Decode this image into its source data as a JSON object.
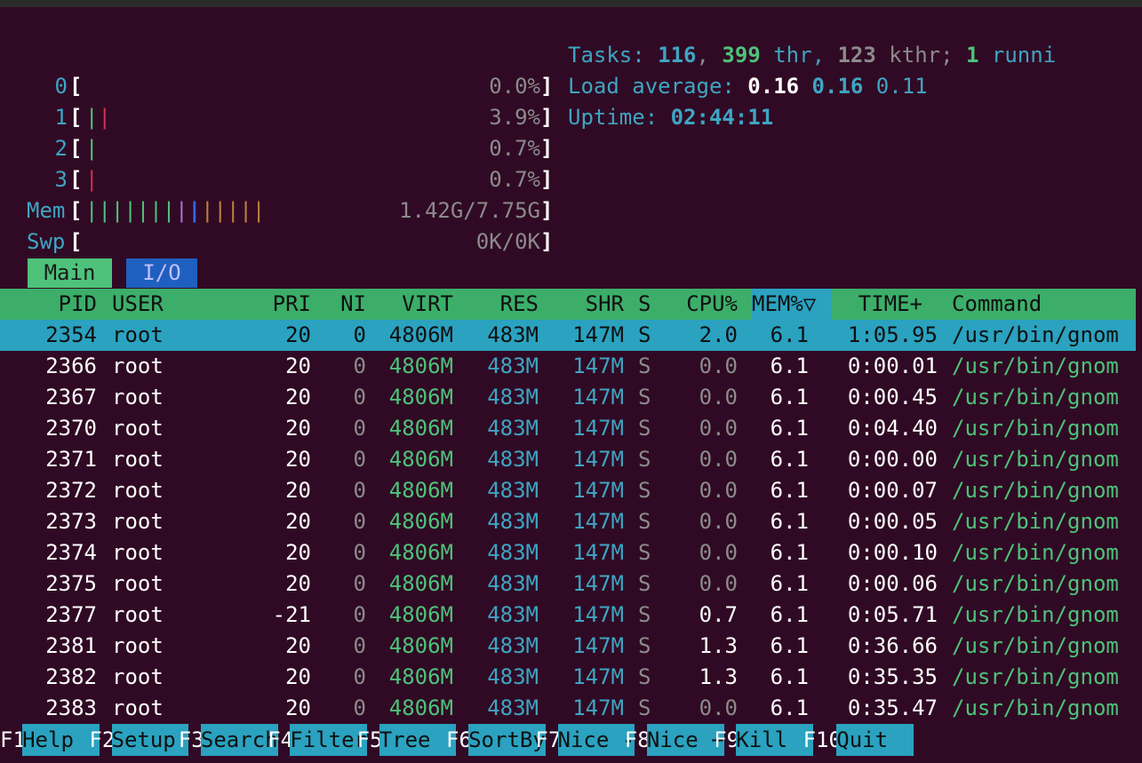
{
  "meters": {
    "cpus": [
      {
        "label": "0",
        "bars": "",
        "value": "0.0%"
      },
      {
        "label": "1",
        "bars": "||",
        "value": "3.9%"
      },
      {
        "label": "2",
        "bars": "|",
        "value": "0.7%"
      },
      {
        "label": "3",
        "bars": "|",
        "value": "0.7%"
      }
    ],
    "mem": {
      "label": "Mem",
      "value": "1.42G/7.75G"
    },
    "swp": {
      "label": "Swp",
      "value": "0K/0K"
    }
  },
  "summary": {
    "tasks_label": "Tasks: ",
    "tasks": "116",
    "thr": "399",
    "thr_label": " thr, ",
    "kthr": "123",
    "kthr_label": " kthr; ",
    "running": "1",
    "running_label": " runni",
    "load_label": "Load average: ",
    "load1": "0.16",
    "load5": "0.16",
    "load15": "0.11",
    "uptime_label": "Uptime: ",
    "uptime": "02:44:11"
  },
  "tabs": {
    "main": "Main",
    "io": "I/O"
  },
  "columns": {
    "pid": "PID",
    "user": "USER",
    "pri": "PRI",
    "ni": "NI",
    "virt": "VIRT",
    "res": "RES",
    "shr": "SHR",
    "s": "S",
    "cpu": "CPU%",
    "mem": "MEM%▽",
    "time": "TIME+",
    "command": "Command"
  },
  "rows": [
    {
      "pid": "2354",
      "user": "root",
      "pri": "20",
      "ni": "0",
      "virt": "4806M",
      "res": "483M",
      "shr": "147M",
      "s": "S",
      "cpu": "2.0",
      "mem": "6.1",
      "time": "1:05.95",
      "command": "/usr/bin/gnom"
    },
    {
      "pid": "2366",
      "user": "root",
      "pri": "20",
      "ni": "0",
      "virt": "4806M",
      "res": "483M",
      "shr": "147M",
      "s": "S",
      "cpu": "0.0",
      "mem": "6.1",
      "time": "0:00.01",
      "command": "/usr/bin/gnom"
    },
    {
      "pid": "2367",
      "user": "root",
      "pri": "20",
      "ni": "0",
      "virt": "4806M",
      "res": "483M",
      "shr": "147M",
      "s": "S",
      "cpu": "0.0",
      "mem": "6.1",
      "time": "0:00.45",
      "command": "/usr/bin/gnom"
    },
    {
      "pid": "2370",
      "user": "root",
      "pri": "20",
      "ni": "0",
      "virt": "4806M",
      "res": "483M",
      "shr": "147M",
      "s": "S",
      "cpu": "0.0",
      "mem": "6.1",
      "time": "0:04.40",
      "command": "/usr/bin/gnom"
    },
    {
      "pid": "2371",
      "user": "root",
      "pri": "20",
      "ni": "0",
      "virt": "4806M",
      "res": "483M",
      "shr": "147M",
      "s": "S",
      "cpu": "0.0",
      "mem": "6.1",
      "time": "0:00.00",
      "command": "/usr/bin/gnom"
    },
    {
      "pid": "2372",
      "user": "root",
      "pri": "20",
      "ni": "0",
      "virt": "4806M",
      "res": "483M",
      "shr": "147M",
      "s": "S",
      "cpu": "0.0",
      "mem": "6.1",
      "time": "0:00.07",
      "command": "/usr/bin/gnom"
    },
    {
      "pid": "2373",
      "user": "root",
      "pri": "20",
      "ni": "0",
      "virt": "4806M",
      "res": "483M",
      "shr": "147M",
      "s": "S",
      "cpu": "0.0",
      "mem": "6.1",
      "time": "0:00.05",
      "command": "/usr/bin/gnom"
    },
    {
      "pid": "2374",
      "user": "root",
      "pri": "20",
      "ni": "0",
      "virt": "4806M",
      "res": "483M",
      "shr": "147M",
      "s": "S",
      "cpu": "0.0",
      "mem": "6.1",
      "time": "0:00.10",
      "command": "/usr/bin/gnom"
    },
    {
      "pid": "2375",
      "user": "root",
      "pri": "20",
      "ni": "0",
      "virt": "4806M",
      "res": "483M",
      "shr": "147M",
      "s": "S",
      "cpu": "0.0",
      "mem": "6.1",
      "time": "0:00.06",
      "command": "/usr/bin/gnom"
    },
    {
      "pid": "2377",
      "user": "root",
      "pri": "-21",
      "ni": "0",
      "virt": "4806M",
      "res": "483M",
      "shr": "147M",
      "s": "S",
      "cpu": "0.7",
      "mem": "6.1",
      "time": "0:05.71",
      "command": "/usr/bin/gnom"
    },
    {
      "pid": "2381",
      "user": "root",
      "pri": "20",
      "ni": "0",
      "virt": "4806M",
      "res": "483M",
      "shr": "147M",
      "s": "S",
      "cpu": "1.3",
      "mem": "6.1",
      "time": "0:36.66",
      "command": "/usr/bin/gnom"
    },
    {
      "pid": "2382",
      "user": "root",
      "pri": "20",
      "ni": "0",
      "virt": "4806M",
      "res": "483M",
      "shr": "147M",
      "s": "S",
      "cpu": "1.3",
      "mem": "6.1",
      "time": "0:35.35",
      "command": "/usr/bin/gnom"
    },
    {
      "pid": "2383",
      "user": "root",
      "pri": "20",
      "ni": "0",
      "virt": "4806M",
      "res": "483M",
      "shr": "147M",
      "s": "S",
      "cpu": "0.0",
      "mem": "6.1",
      "time": "0:35.47",
      "command": "/usr/bin/gnom"
    }
  ],
  "fkeys": [
    {
      "key": "F1",
      "label": "Help  "
    },
    {
      "key": "F2",
      "label": "Setup "
    },
    {
      "key": "F3",
      "label": "Search"
    },
    {
      "key": "F4",
      "label": "Filter"
    },
    {
      "key": "F5",
      "label": "Tree  "
    },
    {
      "key": "F6",
      "label": "SortBy"
    },
    {
      "key": "F7",
      "label": "Nice -"
    },
    {
      "key": "F8",
      "label": "Nice +"
    },
    {
      "key": "F9",
      "label": "Kill  "
    },
    {
      "key": "F10",
      "label": "Quit  "
    }
  ],
  "colors": {
    "background": "#300a24",
    "header": "#3cae6a",
    "selection": "#2aa2c0",
    "cyan": "#3ea5c3",
    "green": "#4ec27a"
  }
}
